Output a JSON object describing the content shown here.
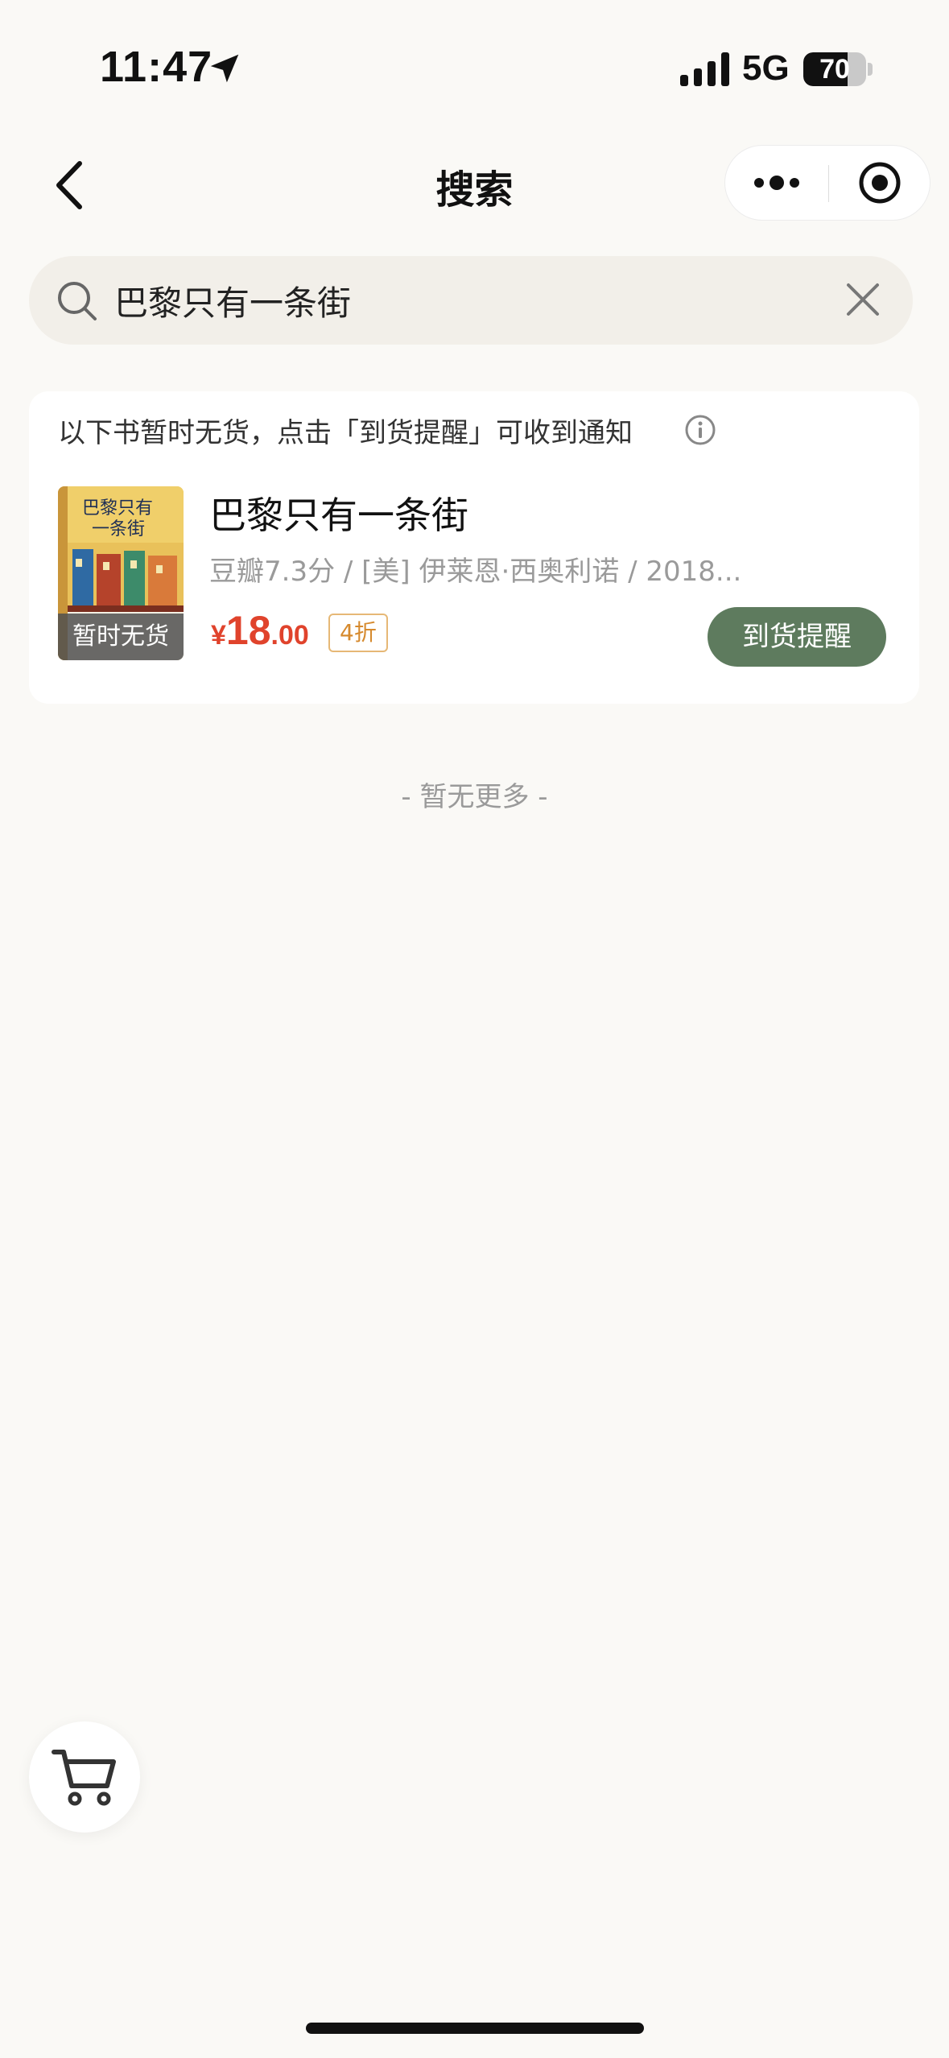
{
  "status_bar": {
    "time": "11:47",
    "network": "5G",
    "battery": "70",
    "battery_level": 0.7
  },
  "nav": {
    "title": "搜索"
  },
  "search": {
    "query": "巴黎只有一条街",
    "placeholder": ""
  },
  "results": {
    "notice": "以下书暂时无货，点击「到货提醒」可收到通知",
    "items": [
      {
        "title": "巴黎只有一条街",
        "meta": "豆瓣7.3分 / [美] 伊莱恩·西奥利诺 / 2018...",
        "price_symbol": "¥",
        "price_int": "18",
        "price_dec": ".00",
        "discount": "4折",
        "stock_status": "暂时无货",
        "notify_label": "到货提醒"
      }
    ]
  },
  "footer": {
    "no_more": "- 暂无更多 -"
  },
  "colors": {
    "background": "#FAF9F6",
    "accent_green": "#5E7B5E",
    "price_red": "#E0432C",
    "discount_orange": "#D68A2E"
  },
  "icons": [
    "location-arrow-icon",
    "signal-icon",
    "back-chevron-icon",
    "more-icon",
    "target-icon",
    "search-icon",
    "clear-icon",
    "info-icon",
    "cart-icon"
  ]
}
